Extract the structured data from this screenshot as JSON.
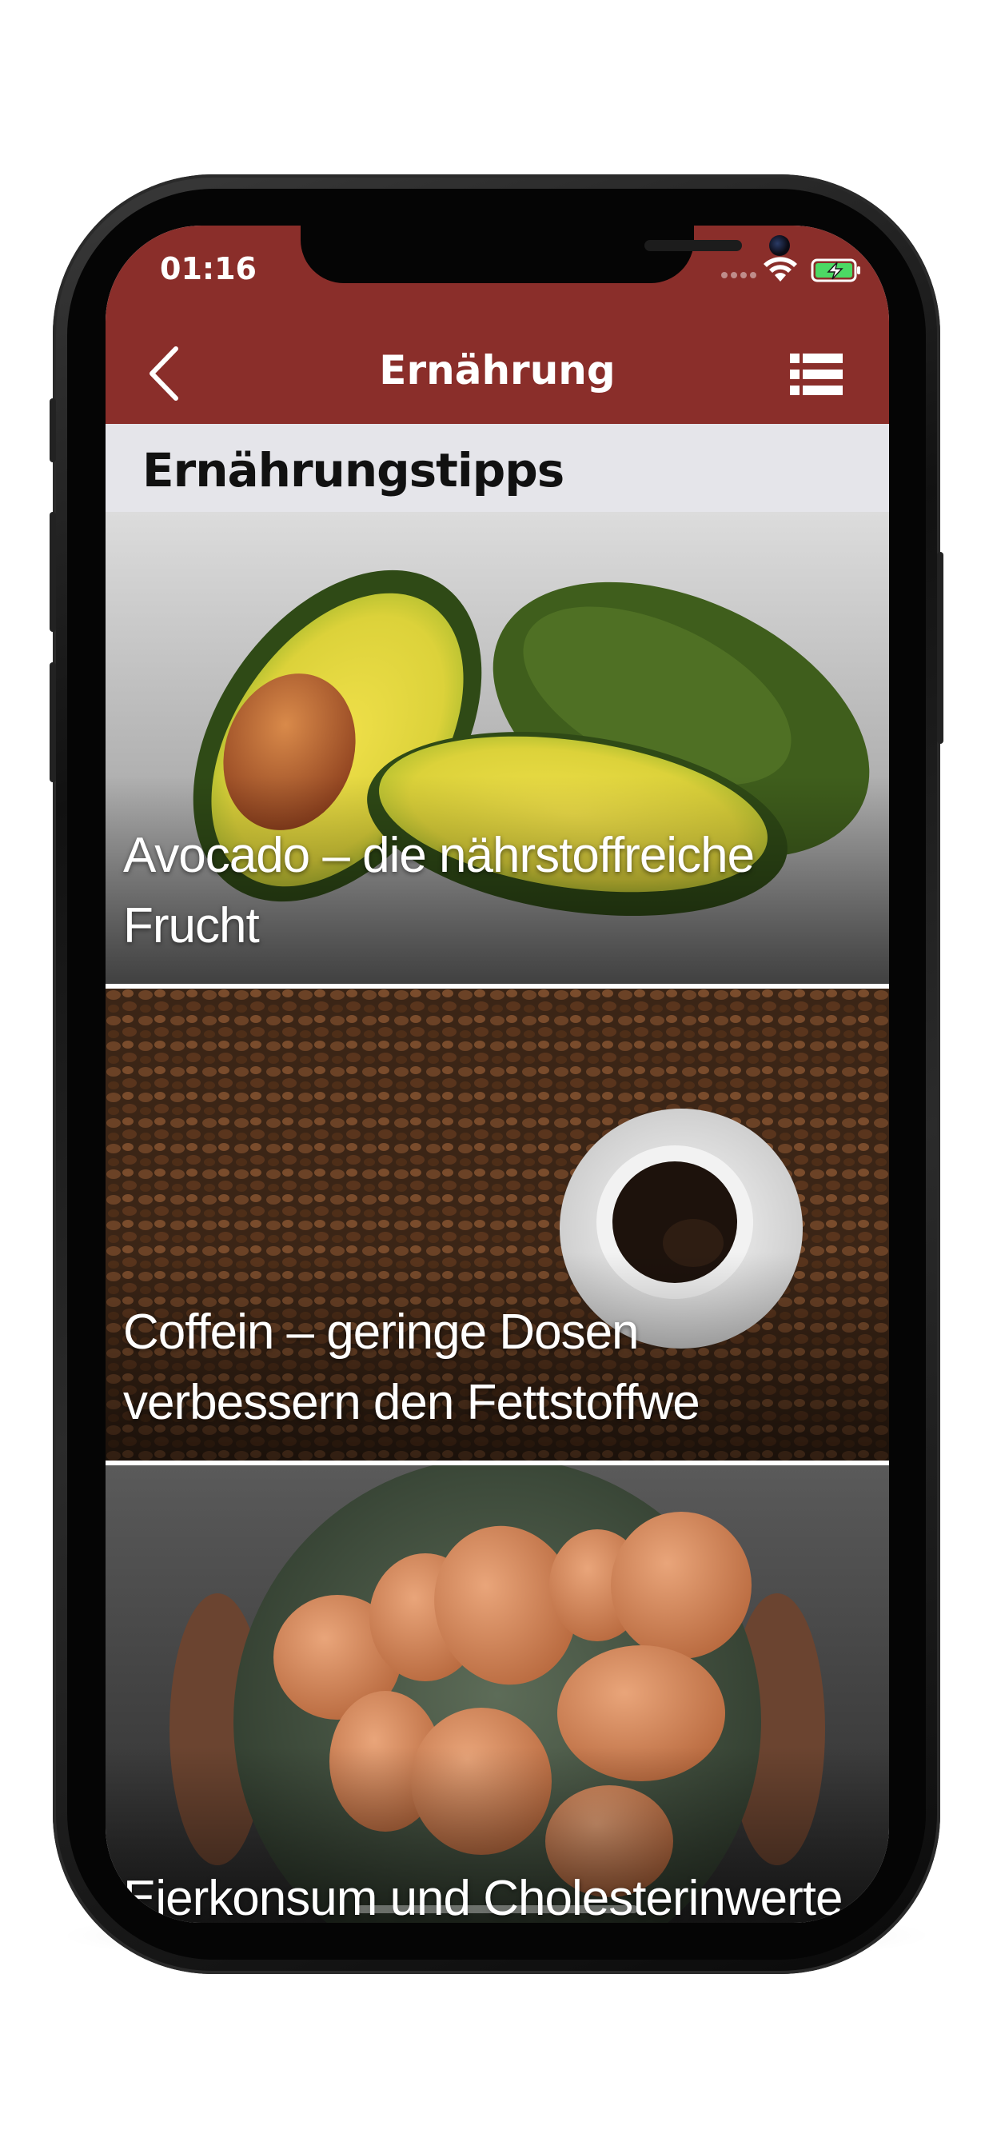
{
  "status_bar": {
    "time": "01:16"
  },
  "nav": {
    "title": "Ernährung",
    "back_icon": "chevron-left-icon",
    "menu_icon": "list-icon"
  },
  "section": {
    "title": "Ernährungstipps"
  },
  "articles": [
    {
      "title": "Avocado – die nährstoffreiche Frucht",
      "image": "avocado-image"
    },
    {
      "title": "Coffein – geringe Dosen verbessern den Fettstoffwe",
      "image": "coffee-image"
    },
    {
      "title": "Eierkonsum und Cholesterinwerte",
      "image": "eggs-image"
    }
  ],
  "colors": {
    "header": "#8a2e2a",
    "section_bg": "#e5e5ea"
  }
}
